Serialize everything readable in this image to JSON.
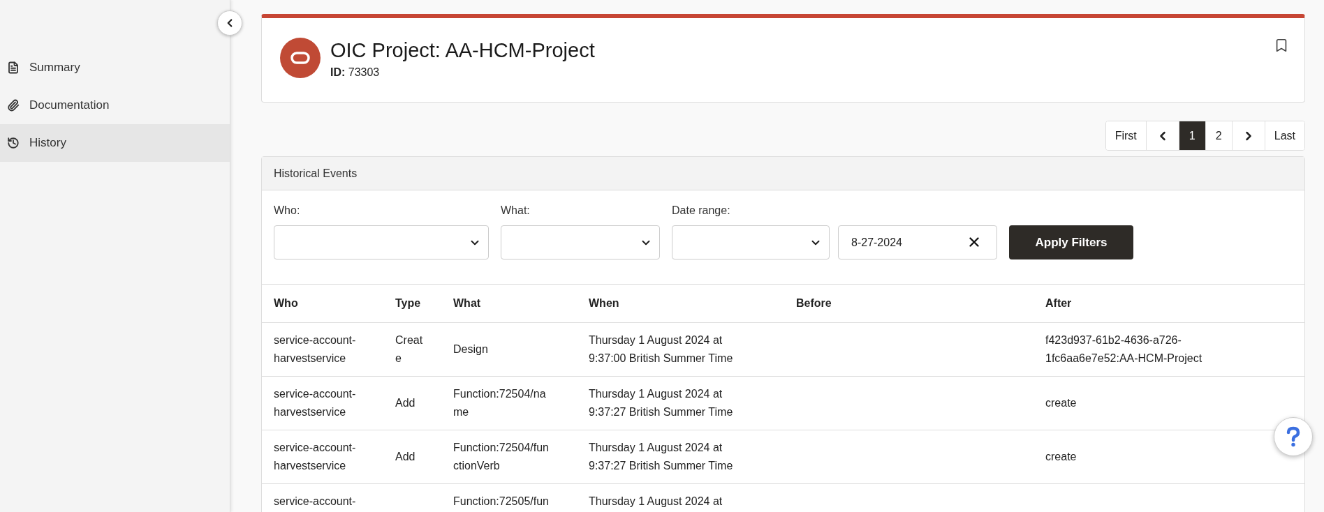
{
  "sidebar": {
    "items": [
      {
        "label": "Summary",
        "selected": false
      },
      {
        "label": "Documentation",
        "selected": false
      },
      {
        "label": "History",
        "selected": true
      }
    ]
  },
  "header": {
    "title": "OIC Project: AA-HCM-Project",
    "id_line": "**ID:** 73303"
  },
  "pagination": [
    {
      "kind": "text",
      "label": "First",
      "selected": false
    },
    {
      "kind": "prev",
      "selected": false
    },
    {
      "kind": "text",
      "label": "1",
      "selected": true
    },
    {
      "kind": "text",
      "label": "2",
      "selected": false
    },
    {
      "kind": "next",
      "selected": false
    },
    {
      "kind": "text",
      "label": "Last",
      "selected": false
    }
  ],
  "panel": {
    "title": "Historical Events",
    "filters": [
      {
        "kind": "select",
        "label": "Who:"
      },
      {
        "kind": "select",
        "label": "What:"
      },
      {
        "kind": "select",
        "label": "Date range:"
      },
      {
        "kind": "date",
        "value": "8-27-2024"
      }
    ],
    "apply_button": "Apply Filters"
  },
  "table": {
    "columns": [
      "Who",
      "Type",
      "What",
      "When",
      "Before",
      "After"
    ],
    "rows": [
      {
        "cut_off": false,
        "who": "service-account-harvestservice",
        "type": "Create",
        "what": "Design",
        "when": "Thursday 1 August 2024 at 9:37:00 British Summer Time",
        "after": "f423d937-61b2-4636-a726-1fc6aa6e7e52:AA-HCM-Project"
      },
      {
        "cut_off": false,
        "who": "service-account-harvestservice",
        "type": "Add",
        "what": "Function:72504/name",
        "when": "Thursday 1 August 2024 at 9:37:27 British Summer Time",
        "after": "create"
      },
      {
        "cut_off": false,
        "who": "service-account-harvestservice",
        "type": "Add",
        "what": "Function:72504/functionVerb",
        "when": "Thursday 1 August 2024 at 9:37:27 British Summer Time",
        "after": "create"
      },
      {
        "cut_off": true,
        "who": "service-account-",
        "what": "Function:72505/fun",
        "when": "Thursday 1 August 2024 at"
      }
    ]
  }
}
